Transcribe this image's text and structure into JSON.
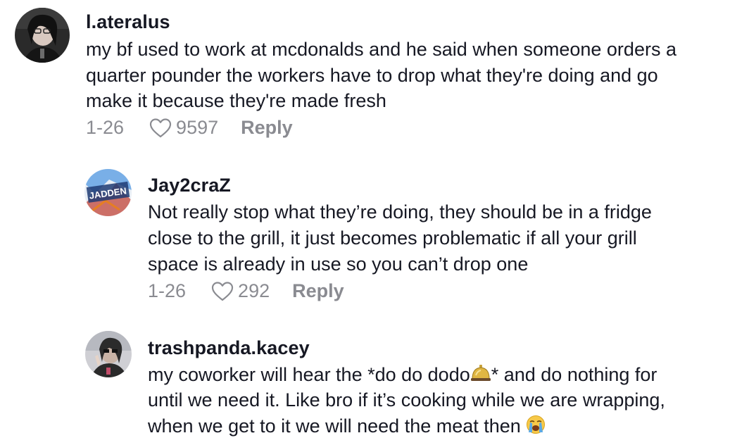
{
  "comments": [
    {
      "username": "l.ateralus",
      "lines": [
        "my bf used to work at mcdonalds and he said when someone orders a",
        "quarter pounder the workers have to drop what they're doing and go",
        "make it because they're made fresh"
      ],
      "date": "1-26",
      "likes": "9597",
      "reply_label": "Reply"
    },
    {
      "username": "Jay2craZ",
      "avatar_text": "JADDEN",
      "lines": [
        "Not really stop what they’re doing, they should be in a fridge",
        "close to the grill, it just becomes problematic if all your grill",
        "space is already in use so you can’t drop one"
      ],
      "date": "1-26",
      "likes": "292",
      "reply_label": "Reply"
    },
    {
      "username": "trashpanda.kacey",
      "lines": [
        "my coworker will hear the *do do dodo",
        "* and do nothing for",
        "until we need it. Like bro if it’s cooking while we are wrapping,",
        "when we get to it we will need the meat then "
      ]
    }
  ],
  "icons": {
    "heart": "heart-outline-icon",
    "bell_emoji": "bellhop-bell-emoji",
    "cry_emoji": "loudly-crying-face-emoji"
  },
  "colors": {
    "text": "#161823",
    "meta": "#8a8b91"
  }
}
